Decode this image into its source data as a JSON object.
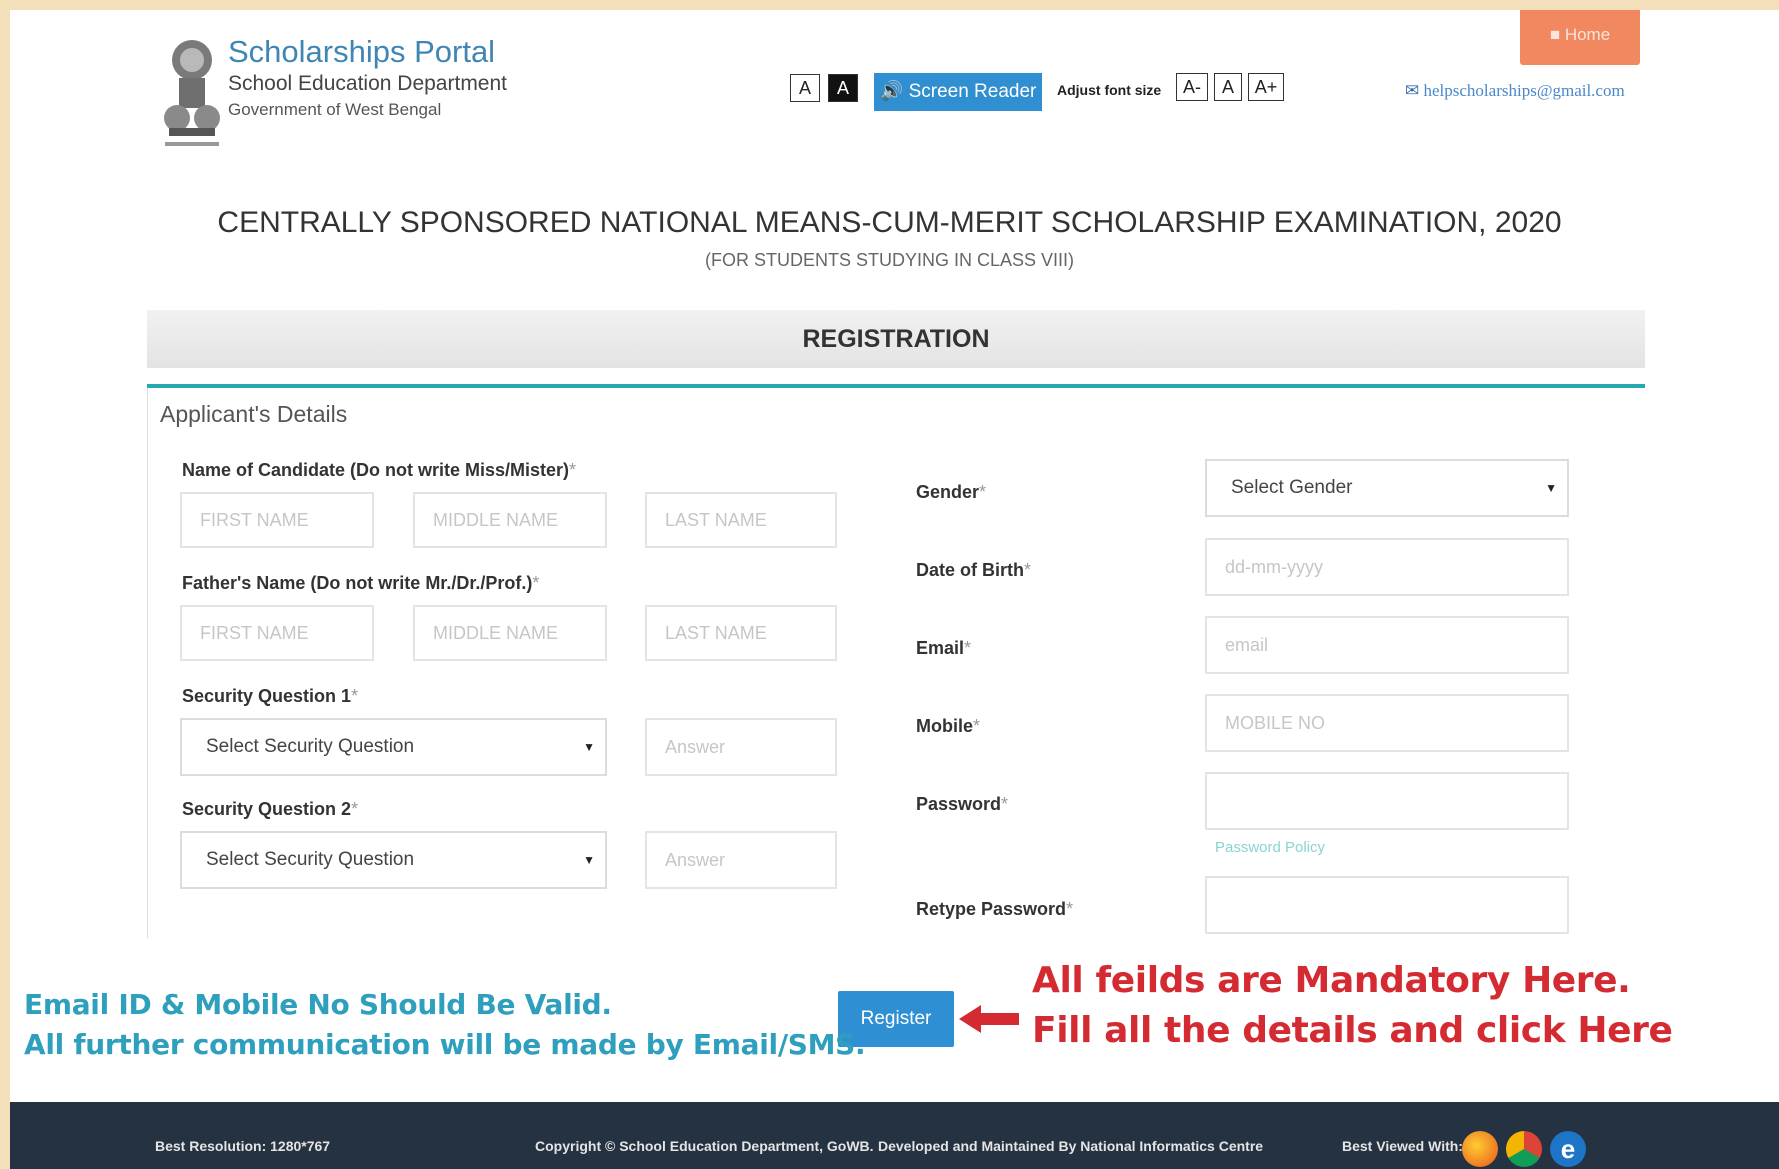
{
  "header": {
    "portal_title": "Scholarships Portal",
    "department": "School Education Department",
    "government": "Government of West Bengal",
    "contrast_normal": "A",
    "contrast_dark": "A",
    "screen_reader_label": "Screen Reader",
    "adjust_font_label": "Adjust font size",
    "font_decrease": "A-",
    "font_normal": "A",
    "font_increase": "A+",
    "home_label": "Home",
    "help_email": "helpscholarships@gmail.com"
  },
  "page": {
    "title": "CENTRALLY SPONSORED NATIONAL MEANS-CUM-MERIT SCHOLARSHIP EXAMINATION, 2020",
    "subtitle": "(FOR STUDENTS STUDYING IN CLASS VIII)",
    "registration_heading": "REGISTRATION",
    "section_title": "Applicant's Details"
  },
  "form": {
    "candidate_name_label": "Name of Candidate (Do not write Miss/Mister)",
    "father_name_label": "Father's Name (Do not write Mr./Dr./Prof.)",
    "security_q1_label": "Security Question 1",
    "security_q2_label": "Security Question 2",
    "gender_label": "Gender",
    "dob_label": "Date of Birth",
    "email_label": "Email",
    "mobile_label": "Mobile",
    "password_label": "Password",
    "retype_password_label": "Retype Password",
    "required_mark": "*",
    "placeholders": {
      "first_name": "FIRST NAME",
      "middle_name": "MIDDLE NAME",
      "last_name": "LAST NAME",
      "answer": "Answer",
      "dob": "dd-mm-yyyy",
      "email": "email",
      "mobile": "MOBILE NO"
    },
    "security_q1_value": "Select Security Question",
    "security_q2_value": "Select Security Question",
    "gender_value": "Select Gender",
    "password_policy_link": "Password Policy",
    "register_button": "Register"
  },
  "notes": {
    "mandatory_line1": "All feilds are Mandatory Here.",
    "mandatory_line2": "Fill all the details and click Here",
    "valid_line1": "Email ID & Mobile No Should Be Valid.",
    "valid_line2": "All further communication will be made by Email/SMS."
  },
  "footer": {
    "best_resolution": "Best Resolution: 1280*767",
    "copyright": "Copyright © School Education Department, GoWB.",
    "developed_by": "Developed and Maintained By National Informatics Centre",
    "best_viewed": "Best Viewed With:"
  },
  "colors": {
    "accent_blue": "#2e8fd3",
    "home_orange": "#f2885f",
    "teal_line": "#26a9ad",
    "note_red": "#d42b32",
    "note_teal": "#2e9fbd",
    "footer_bg": "#243241"
  }
}
